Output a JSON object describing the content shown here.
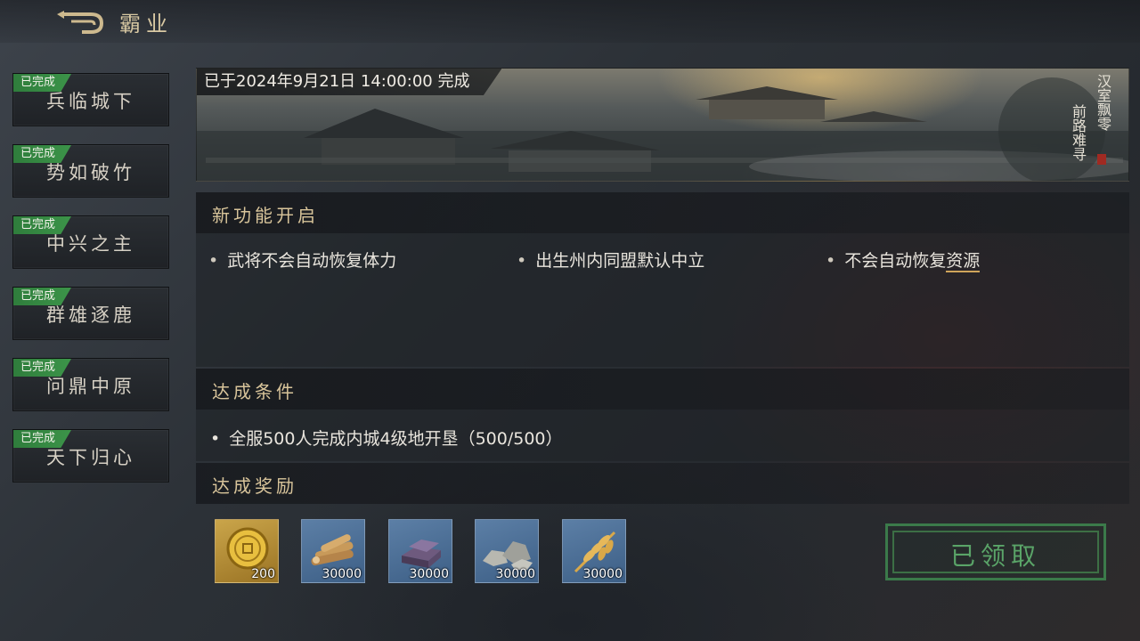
{
  "header": {
    "title": "霸业",
    "back_icon": "back-arrow-icon"
  },
  "sidebar": {
    "items": [
      {
        "label": "兵临城下",
        "badge": "已完成"
      },
      {
        "label": "势如破竹",
        "badge": "已完成"
      },
      {
        "label": "中兴之主",
        "badge": "已完成"
      },
      {
        "label": "群雄逐鹿",
        "badge": "已完成"
      },
      {
        "label": "问鼎中原",
        "badge": "已完成"
      },
      {
        "label": "天下归心",
        "badge": "已完成"
      }
    ]
  },
  "banner": {
    "date_text": "已于2024年9月21日 14:00:00 完成",
    "poem_col1": "汉室飘零",
    "poem_col2": "前路难寻"
  },
  "features": {
    "title": "新功能开启",
    "items": [
      {
        "text": "武将不会自动恢复体力"
      },
      {
        "text": "出生州内同盟默认中立"
      },
      {
        "text": "不会自动恢复",
        "link": "资源"
      }
    ]
  },
  "conditions": {
    "title": "达成条件",
    "items": [
      {
        "text": "全服500人完成内城4级地开垦（500/500）"
      }
    ]
  },
  "rewards": {
    "title": "达成奖励",
    "items": [
      {
        "icon": "gold-coin-icon",
        "qty": "200"
      },
      {
        "icon": "wood-logs-icon",
        "qty": "30000"
      },
      {
        "icon": "iron-ingot-icon",
        "qty": "30000"
      },
      {
        "icon": "stone-icon",
        "qty": "30000"
      },
      {
        "icon": "grain-wheat-icon",
        "qty": "30000"
      }
    ]
  },
  "claim_button": {
    "label": "已领取"
  },
  "colors": {
    "badge_green": "#3c9449",
    "title_gold": "#d8c49a",
    "claimed_green": "#5aa468",
    "link_underline": "#cfa45a"
  }
}
